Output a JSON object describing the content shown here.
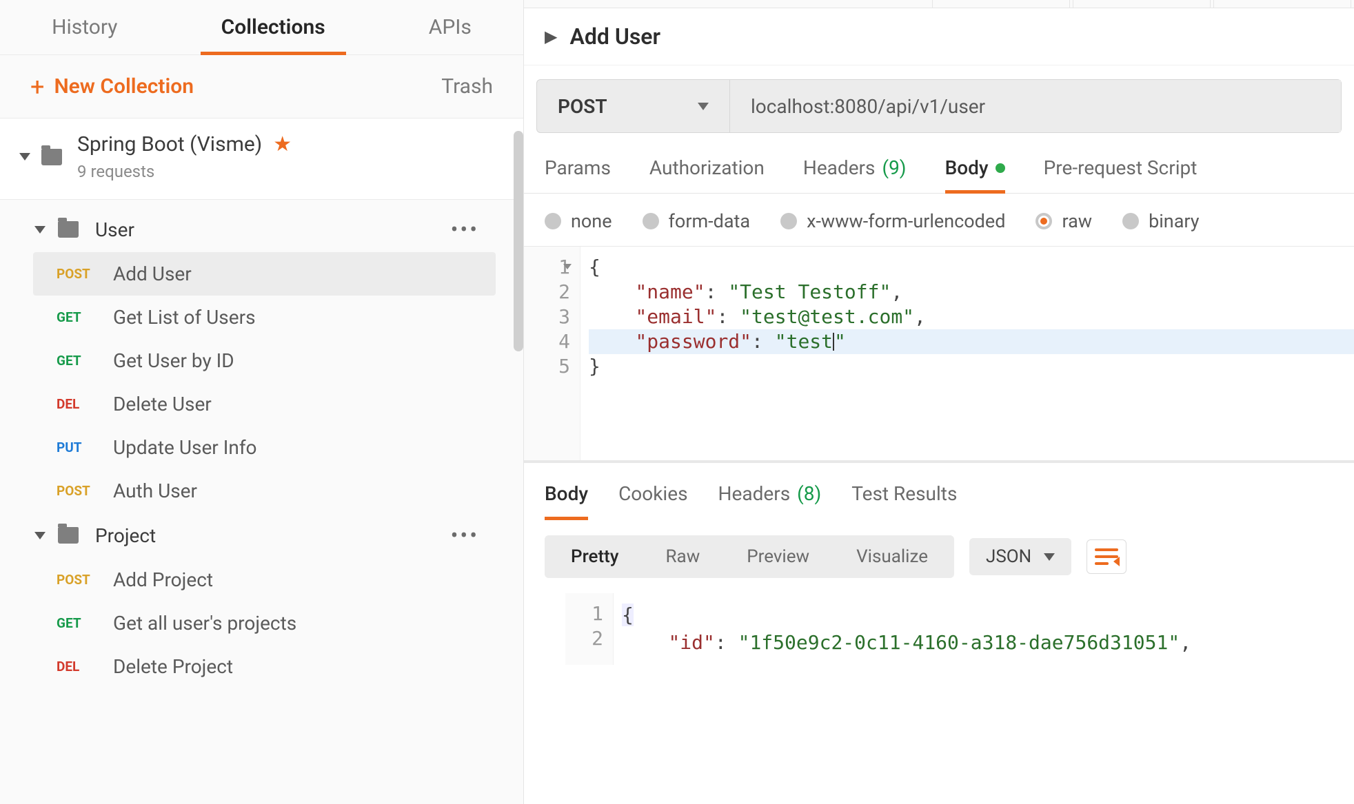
{
  "sidebar": {
    "tabs": {
      "history": "History",
      "collections": "Collections",
      "apis": "APIs"
    },
    "new_collection_label": "New Collection",
    "trash_label": "Trash",
    "collection": {
      "name": "Spring Boot (Visme)",
      "subtitle": "9 requests"
    },
    "folders": [
      {
        "name": "User",
        "requests": [
          {
            "method": "POST",
            "label": "Add User",
            "active": true
          },
          {
            "method": "GET",
            "label": "Get List of Users"
          },
          {
            "method": "GET",
            "label": "Get User by ID"
          },
          {
            "method": "DEL",
            "label": "Delete User"
          },
          {
            "method": "PUT",
            "label": "Update User Info"
          },
          {
            "method": "POST",
            "label": "Auth User"
          }
        ]
      },
      {
        "name": "Project",
        "requests": [
          {
            "method": "POST",
            "label": "Add Project"
          },
          {
            "method": "GET",
            "label": "Get all user's projects"
          },
          {
            "method": "DEL",
            "label": "Delete Project"
          }
        ]
      }
    ]
  },
  "request": {
    "title": "Add User",
    "method": "POST",
    "url": "localhost:8080/api/v1/user",
    "tabs": {
      "params": "Params",
      "authorization": "Authorization",
      "headers": "Headers",
      "headers_count": "(9)",
      "body": "Body",
      "prerequest": "Pre-request Script"
    },
    "body_types": {
      "none": "none",
      "form_data": "form-data",
      "urlencoded": "x-www-form-urlencoded",
      "raw": "raw",
      "binary": "binary"
    },
    "body_json": {
      "line1": "{",
      "line2_key": "\"name\"",
      "line2_val": "\"Test Testoff\"",
      "line3_key": "\"email\"",
      "line3_val": "\"test@test.com\"",
      "line4_key": "\"password\"",
      "line4_val_open": "\"test",
      "line4_val_close": "\"",
      "line5": "}"
    }
  },
  "response": {
    "tabs": {
      "body": "Body",
      "cookies": "Cookies",
      "headers": "Headers",
      "headers_count": "(8)",
      "test_results": "Test Results"
    },
    "view_modes": {
      "pretty": "Pretty",
      "raw": "Raw",
      "preview": "Preview",
      "visualize": "Visualize"
    },
    "format_dropdown": "JSON",
    "body": {
      "line1": "{",
      "line2_key": "\"id\"",
      "line2_val": "\"1f50e9c2-0c11-4160-a318-dae756d31051\""
    }
  }
}
